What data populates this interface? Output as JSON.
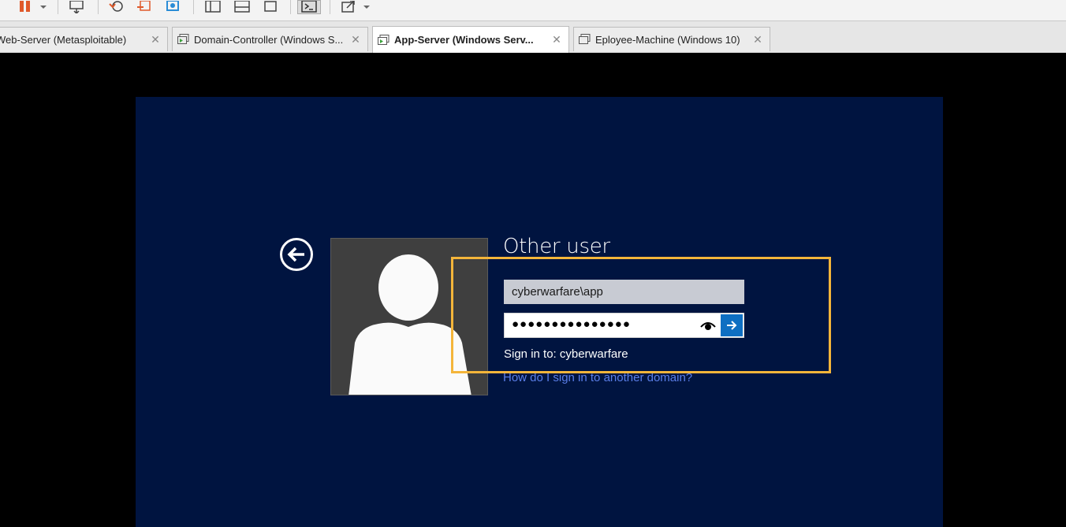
{
  "toolbar": {
    "icons": [
      "pause-icon",
      "dropdown-icon",
      "send-keys-icon",
      "snapshot-icon",
      "revert-icon",
      "snapshot-manager-icon",
      "layout-icon",
      "console-icon",
      "stretch-icon"
    ]
  },
  "tabs": [
    {
      "label": "Web-Server (Metasploitable)",
      "active": false
    },
    {
      "label": "Domain-Controller (Windows S...",
      "active": false
    },
    {
      "label": "App-Server (Windows Serv...",
      "active": true
    },
    {
      "label": "Eployee-Machine (Windows 10)",
      "active": false
    }
  ],
  "login": {
    "title": "Other user",
    "username": "cyberwarfare\\app",
    "password_mask": "●●●●●●●●●●●●●●●",
    "sign_in_to": "Sign in to: cyberwarfare",
    "help_link": "How do I sign in to another domain?"
  },
  "colors": {
    "desktop_bg": "#001440",
    "highlight": "#f4b53a",
    "submit_button": "#0e6fc2",
    "link": "#5a7ee8"
  }
}
